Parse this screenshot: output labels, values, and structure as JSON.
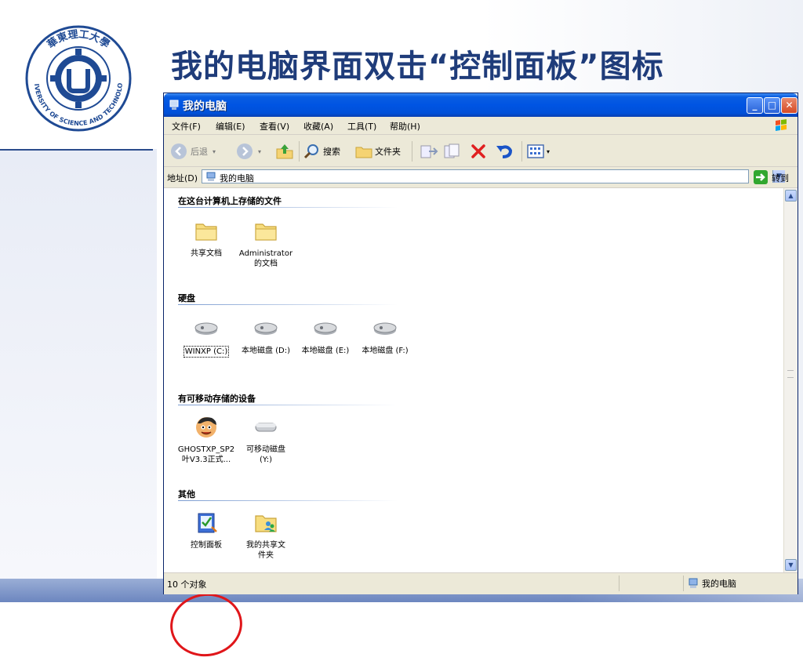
{
  "slide": {
    "title": "我的电脑界面双击“控制面板”图标",
    "logo_text": "華東理工大學 EAST CHINA UNIVERSITY OF SCIENCE AND TECHNOLOGY",
    "colors": {
      "title": "#1f3c7a",
      "accent": "#2b4c8c",
      "circle": "#e0161a"
    }
  },
  "window": {
    "title": "我的电脑",
    "menu": [
      "文件(F)",
      "编辑(E)",
      "查看(V)",
      "收藏(A)",
      "工具(T)",
      "帮助(H)"
    ],
    "toolbar": {
      "back": "后退",
      "search": "搜索",
      "folders": "文件夹"
    },
    "address": {
      "label": "地址(D)",
      "value": "我的电脑",
      "go": "转到"
    },
    "groups": [
      {
        "title": "在这台计算机上存储的文件",
        "items": [
          {
            "label": "共享文档",
            "icon": "folder-icon"
          },
          {
            "label": "Administrator 的文档",
            "line1": "Administrator",
            "line2": "的文档",
            "icon": "folder-icon"
          }
        ]
      },
      {
        "title": "硬盘",
        "items": [
          {
            "label": "WINXP (C:)",
            "icon": "hard-drive-icon"
          },
          {
            "label": "本地磁盘 (D:)",
            "icon": "hard-drive-icon"
          },
          {
            "label": "本地磁盘 (E:)",
            "icon": "hard-drive-icon"
          },
          {
            "label": "本地磁盘 (F:)",
            "icon": "hard-drive-icon"
          }
        ]
      },
      {
        "title": "有可移动存储的设备",
        "items": [
          {
            "label": "GHOSTXP_SP2 叶V3.3正式...",
            "line1": "GHOSTXP_SP2",
            "line2": "叶V3.3正式...",
            "icon": "cd-drive-icon"
          },
          {
            "label": "可移动磁盘 (Y:)",
            "line1": "可移动磁盘",
            "line2": "(Y:)",
            "icon": "removable-disk-icon"
          }
        ]
      },
      {
        "title": "其他",
        "items": [
          {
            "label": "控制面板",
            "icon": "control-panel-icon"
          },
          {
            "label": "我的共享文件夹",
            "line1": "我的共享文",
            "line2": "件夹",
            "icon": "shared-folder-icon"
          }
        ]
      }
    ],
    "status": {
      "count": "10 个对象",
      "location": "我的电脑"
    }
  }
}
